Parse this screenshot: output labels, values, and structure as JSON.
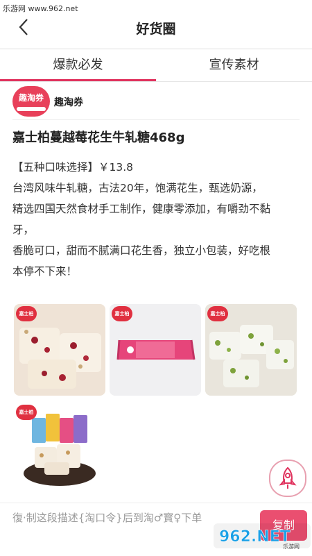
{
  "watermark_top": "乐游网 www.962.net",
  "navbar": {
    "title": "好货圈"
  },
  "tabs": [
    {
      "label": "爆款必发",
      "active": true
    },
    {
      "label": "宣传素材",
      "active": false
    }
  ],
  "author": {
    "name": "趣淘券",
    "avatar_text": "趣淘券"
  },
  "product": {
    "title": "嘉士柏蔓越莓花生牛轧糖468g",
    "desc_lines": [
      "【五种口味选择】￥13.8",
      "台湾风味牛轧糖，古法20年，饱满花生，甄选奶源，",
      "精选四国天然食材手工制作，健康零添加，有嚼劲不黏",
      "牙，",
      "香脆可口，甜而不腻满口花生香，独立小包装，好吃根",
      "本停不下来！"
    ],
    "brand_badge": "嘉士柏"
  },
  "bottom": {
    "copy_text": "復·制这段描述{淘口令}后到淘♂寳♀下单",
    "copy_button": "复制"
  },
  "watermark_bottom": "962.NET",
  "watermark_bottom_sub": "乐游网",
  "colors": {
    "accent": "#e0335e",
    "button": "#ea4f70"
  }
}
